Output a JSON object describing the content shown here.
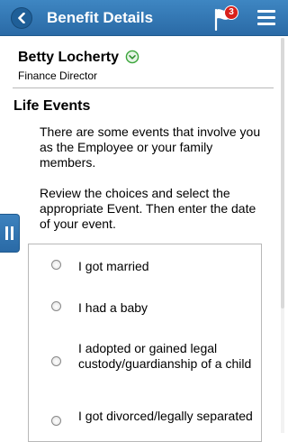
{
  "header": {
    "title": "Benefit Details",
    "notification_count": "3",
    "back_icon": "chevron-left-icon",
    "notification_icon": "flag-icon",
    "menu_icon": "hamburger-menu-icon",
    "background_color": "#2f74b1"
  },
  "person": {
    "name": "Betty Locherty",
    "title": "Finance Director",
    "expand_icon": "chevron-down-circle-icon",
    "expand_color": "#3aa53a"
  },
  "life_events": {
    "heading": "Life Events",
    "intro": "There are some events that involve you as the Employee or your family members.",
    "instructions": "Review the choices and select the appropriate Event. Then enter the date of your event.",
    "choices": [
      {
        "label": "I got married",
        "selected": false
      },
      {
        "label": "I had a baby",
        "selected": false
      },
      {
        "label": "I adopted or gained legal custody/guardianship of a child",
        "selected": false
      },
      {
        "label": "I got divorced/legally separated",
        "selected": false
      }
    ]
  },
  "side_tab": {
    "icon": "pause-bars-icon"
  }
}
